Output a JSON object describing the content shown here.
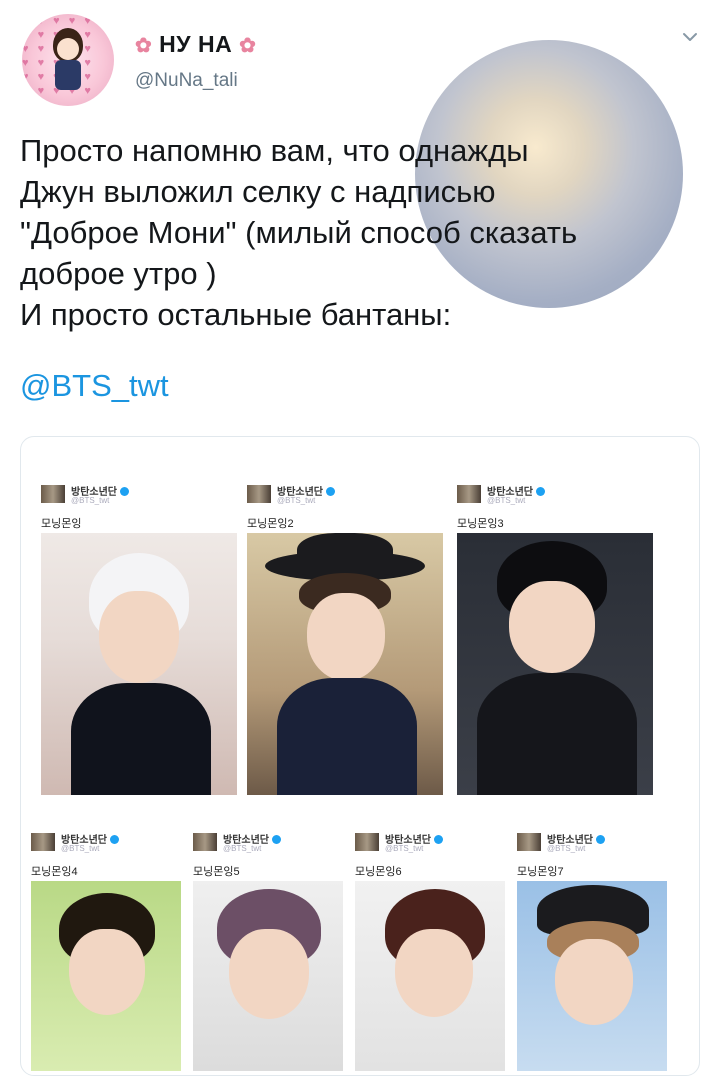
{
  "header": {
    "display_name": "НУ НА",
    "username": "@NuNa_tali",
    "flower_glyph": "✿",
    "more_icon": "chevron-down-icon"
  },
  "tweet": {
    "lines": [
      "Просто напомню вам, что однажды",
      "Джун выложил селку с надписью",
      "\"Доброе Мони\" (милый способ сказать",
      "доброе утро )",
      "И просто остальные бантаны:"
    ],
    "mention": "@BTS_twt"
  },
  "media": {
    "screenshots": [
      {
        "account": "방탄소년단",
        "handle": "@BTS_twt",
        "caption": "모닝몬잉"
      },
      {
        "account": "방탄소년단",
        "handle": "@BTS_twt",
        "caption": "모닝몬잉2"
      },
      {
        "account": "방탄소년단",
        "handle": "@BTS_twt",
        "caption": "모닝몬잉3"
      },
      {
        "account": "방탄소년단",
        "handle": "@BTS_twt",
        "caption": "모닝몬잉4"
      },
      {
        "account": "방탄소년단",
        "handle": "@BTS_twt",
        "caption": "모닝몬잉5"
      },
      {
        "account": "방탄소년단",
        "handle": "@BTS_twt",
        "caption": "모닝몬잉6"
      },
      {
        "account": "방탄소년단",
        "handle": "@BTS_twt",
        "caption": "모닝몬잉7"
      }
    ]
  },
  "colors": {
    "link": "#1b95e0",
    "text": "#14171a",
    "secondary": "#657786",
    "border": "#e1e8ed",
    "verified": "#1da1f2"
  }
}
